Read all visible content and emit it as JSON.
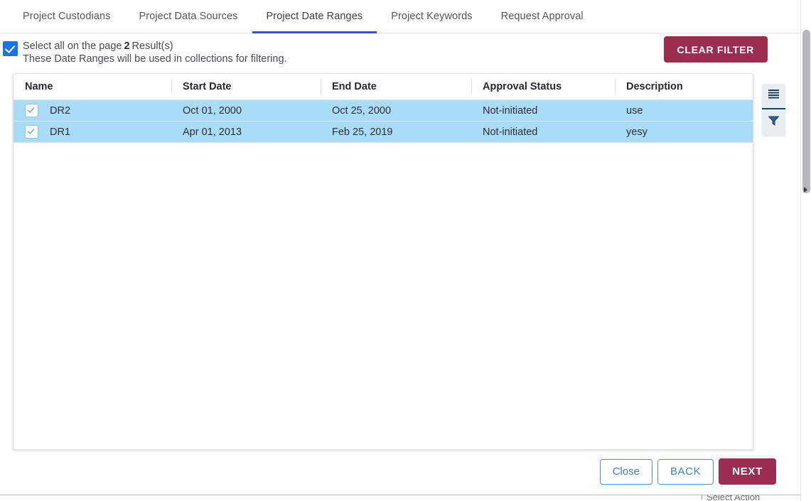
{
  "tabs": [
    {
      "label": "Project Custodians",
      "active": false
    },
    {
      "label": "Project Data Sources",
      "active": false
    },
    {
      "label": "Project Date Ranges",
      "active": true
    },
    {
      "label": "Project Keywords",
      "active": false
    },
    {
      "label": "Request Approval",
      "active": false
    }
  ],
  "select_header": {
    "select_all_label": "Select all on the page",
    "result_count": "2",
    "result_suffix": "Result(s)",
    "hint": "These Date Ranges will be used in collections for filtering.",
    "clear_filter_label": "CLEAR FILTER"
  },
  "table": {
    "columns": [
      "Name",
      "Start Date",
      "End Date",
      "Approval Status",
      "Description"
    ],
    "rows": [
      {
        "selected": true,
        "name": "DR2",
        "start_date": "Oct 01, 2000",
        "end_date": "Oct 25, 2000",
        "approval_status": "Not-initiated",
        "description": "use"
      },
      {
        "selected": true,
        "name": "DR1",
        "start_date": "Apr 01, 2013",
        "end_date": "Feb 25, 2019",
        "approval_status": "Not-initiated",
        "description": "yesy"
      }
    ]
  },
  "icon_rail": {
    "columns_icon": "hamburger-list-icon",
    "filter_icon": "funnel-filter-icon"
  },
  "footer": {
    "close_label": "Close",
    "back_label": "BACK",
    "next_label": "NEXT"
  },
  "background_page": {
    "partial_text": "Select Action"
  },
  "colors": {
    "accent_maroon": "#9c2d4f",
    "accent_blue": "#3f51b5",
    "checkbox_blue": "#1a73e8",
    "row_selected": "#aadcf8",
    "link_blue": "#3f7fbf"
  }
}
